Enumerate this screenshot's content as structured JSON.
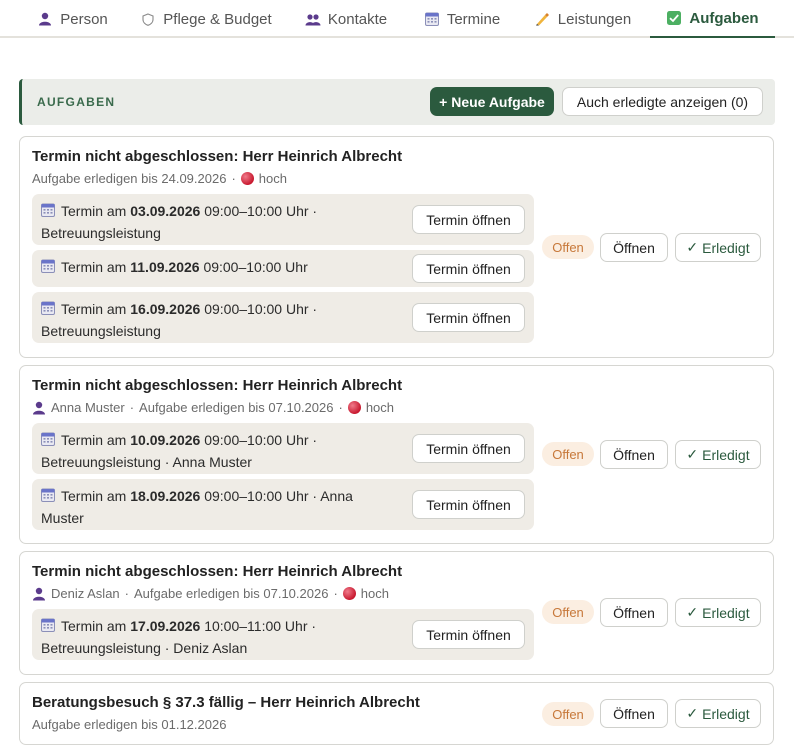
{
  "tabs": [
    {
      "label": "Person",
      "icon": "person-icon"
    },
    {
      "label": "Pflege & Budget",
      "icon": "shield-icon"
    },
    {
      "label": "Kontakte",
      "icon": "contacts-icon"
    },
    {
      "label": "Termine",
      "icon": "calendar-icon"
    },
    {
      "label": "Leistungen",
      "icon": "writing-hand-icon"
    },
    {
      "label": "Aufgaben",
      "icon": "checkbox-icon",
      "active": true
    }
  ],
  "section": {
    "title": "AUFGABEN",
    "new_button": "+ Neue Aufgabe",
    "show_done_button": "Auch erledigte anzeigen (0)"
  },
  "common": {
    "status": "Offen",
    "open": "Öffnen",
    "done": "Erledigt",
    "done_glyph": "✓",
    "open_appointment": "Termin öffnen",
    "appt_prefix": "Termin am",
    "priority_label": "hoch",
    "sep": "·"
  },
  "tasks": [
    {
      "title": "Termin nicht abgeschlossen: Herr Heinrich Albrecht",
      "meta_person": "",
      "meta_due": "Aufgabe erledigen bis 24.09.2026",
      "priority": "hoch",
      "appointments": [
        {
          "date": "03.09.2026",
          "time": "09:00–10:00 Uhr ·",
          "detail": "Betreuungsleistung"
        },
        {
          "date": "11.09.2026",
          "time": "09:00–10:00 Uhr",
          "detail": ""
        },
        {
          "date": "16.09.2026",
          "time": "09:00–10:00 Uhr ·",
          "detail": "Betreuungsleistung"
        }
      ]
    },
    {
      "title": "Termin nicht abgeschlossen: Herr Heinrich Albrecht",
      "meta_person": "Anna Muster",
      "meta_due": "Aufgabe erledigen bis 07.10.2026",
      "priority": "hoch",
      "appointments": [
        {
          "date": "10.09.2026",
          "time": "09:00–10:00 Uhr ·",
          "detail": "Betreuungsleistung · Anna Muster"
        },
        {
          "date": "18.09.2026",
          "time": "09:00–10:00 Uhr · Anna",
          "detail": "Muster"
        }
      ]
    },
    {
      "title": "Termin nicht abgeschlossen: Herr Heinrich Albrecht",
      "meta_person": "Deniz Aslan",
      "meta_due": "Aufgabe erledigen bis 07.10.2026",
      "priority": "hoch",
      "appointments": [
        {
          "date": "17.09.2026",
          "time": "10:00–11:00 Uhr ·",
          "detail": "Betreuungsleistung · Deniz Aslan"
        }
      ]
    },
    {
      "title": "Beratungsbesuch § 37.3 fällig – Herr Heinrich Albrecht",
      "meta_person": "",
      "meta_due": "Aufgabe erledigen bis 01.12.2026",
      "priority": "",
      "appointments": []
    }
  ],
  "colors": {
    "accent": "#2b5a3e",
    "status_bg": "#fbeee1",
    "status_text": "#c7783a",
    "appointment_bg": "#efece6",
    "priority_dot": "#c8192f"
  }
}
